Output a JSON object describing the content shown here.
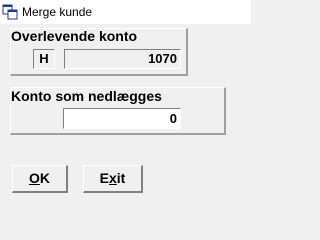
{
  "window": {
    "title": "Merge kunde",
    "icon": "app-window-icon"
  },
  "surviving_account": {
    "label": "Overlevende konto",
    "type_code": "H",
    "account_number": "1070"
  },
  "account_to_close": {
    "label": "Konto som nedlægges",
    "account_number": "0"
  },
  "buttons": {
    "ok_mnemonic": "O",
    "ok_rest": "K",
    "exit_prefix": "E",
    "exit_mnemonic": "x",
    "exit_rest": "it"
  }
}
